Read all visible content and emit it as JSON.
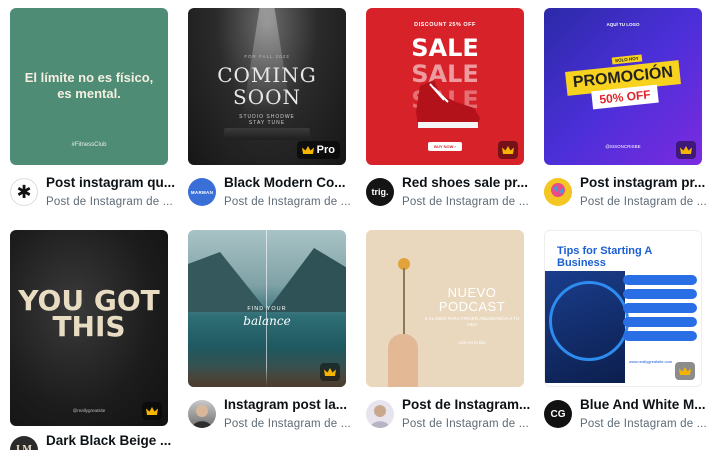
{
  "cards": [
    {
      "title": "Post instagram qu...",
      "subtitle": "Post de Instagram de ...",
      "avatar_text": "✱",
      "thumb": {
        "headline": "El límite no es físico, es mental.",
        "footer": "#FitnessClub"
      },
      "badge": "none"
    },
    {
      "title": "Black Modern Co...",
      "subtitle": "Post de Instagram de ...",
      "avatar_text": "MARMAN",
      "thumb": {
        "top": "FOR FALL 2023",
        "headline": "COMING SOON",
        "studio": "STUDIO SHODWE",
        "studio_sub": "STAY TUNE"
      },
      "badge": "pro",
      "badge_label": "Pro"
    },
    {
      "title": "Red shoes sale pr...",
      "subtitle": "Post de Instagram de ...",
      "avatar_text": "trig.",
      "thumb": {
        "top": "DISCOUNT 25% OFF",
        "word": "SALE",
        "button": "BUY NOW ›",
        "web": "reallygreatsite.com"
      },
      "badge": "crown"
    },
    {
      "title": "Post instagram pr...",
      "subtitle": "Post de Instagram de ...",
      "avatar_text": "",
      "thumb": {
        "top": "AQUÍ TU LOGO",
        "solo": "SOLO HOY",
        "headline": "PROMOCIÓN",
        "percent": "50% OFF",
        "handle": "@SISONCRISBE"
      },
      "badge": "crown"
    },
    {
      "title": "Dark Black Beige ...",
      "subtitle": "",
      "avatar_text": "LM",
      "thumb": {
        "headline": "YOU GOT THIS",
        "handle": "@reallygreatsite"
      },
      "badge": "crown"
    },
    {
      "title": "Instagram post la...",
      "subtitle": "Post de Instagram de ...",
      "avatar_text": "",
      "thumb": {
        "top": "FIND YOUR",
        "script": "balance"
      },
      "badge": "crown"
    },
    {
      "title": "Post de Instagram...",
      "subtitle": "Post de Instagram de ...",
      "avatar_text": "",
      "thumb": {
        "headline": "NUEVO PODCAST",
        "sub": "5 CLASES PARA ATRAER ABUNDANCIA A TU VIDA",
        "link": "Link en la Bio"
      },
      "badge": "none"
    },
    {
      "title": "Blue And White M...",
      "subtitle": "Post de Instagram de ...",
      "avatar_text": "CG",
      "thumb": {
        "headline": "Tips for Starting A Business",
        "web": "www.reallygreatsite.com"
      },
      "badge": "crown"
    }
  ],
  "colors": {
    "crown": "#f5b400",
    "text": "#0d1216",
    "subtext": "#5e6a75"
  }
}
